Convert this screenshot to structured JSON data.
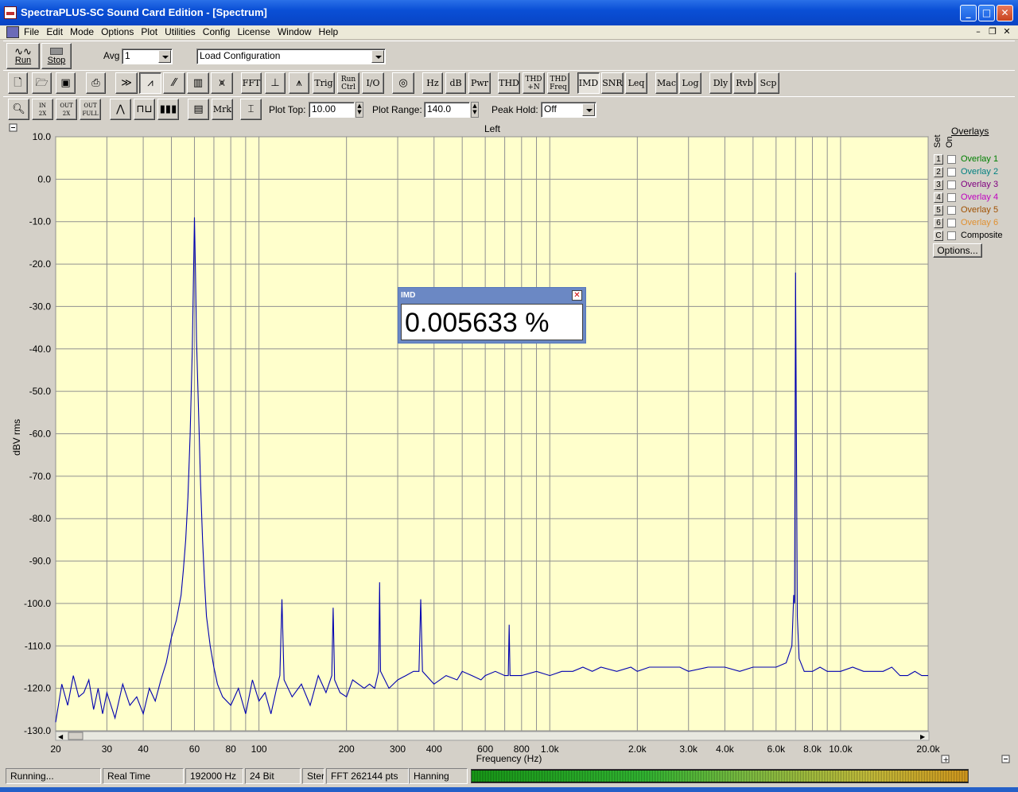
{
  "window": {
    "title": "SpectraPLUS-SC Sound Card Edition - [Spectrum]"
  },
  "menu": [
    "File",
    "Edit",
    "Mode",
    "Options",
    "Plot",
    "Utilities",
    "Config",
    "License",
    "Window",
    "Help"
  ],
  "toolbar1": {
    "run_label": "Run",
    "stop_label": "Stop",
    "avg_label": "Avg",
    "avg_value": "1",
    "config_value": "Load Configuration"
  },
  "toolbar2": {
    "buttons": [
      "FFT",
      "Trig",
      "Run Ctrl",
      "I/O",
      "Hz",
      "dB",
      "Pwr",
      "THD",
      "THD +N",
      "THD Freq",
      "IMD",
      "SNR",
      "Leq",
      "Mac",
      "Log",
      "Dly",
      "Rvb",
      "Scp"
    ]
  },
  "toolbar3": {
    "marker_label": "Mrk",
    "plot_top_label": "Plot Top:",
    "plot_top_value": "10.00",
    "plot_range_label": "Plot Range:",
    "plot_range_value": "140.0",
    "peak_hold_label": "Peak Hold:",
    "peak_hold_value": "Off"
  },
  "overlays": {
    "title": "Overlays",
    "set_label": "Set",
    "on_label": "On",
    "items": [
      {
        "set": "1",
        "label": "Overlay 1",
        "color": "#008000"
      },
      {
        "set": "2",
        "label": "Overlay 2",
        "color": "#008080"
      },
      {
        "set": "3",
        "label": "Overlay 3",
        "color": "#800080"
      },
      {
        "set": "4",
        "label": "Overlay 4",
        "color": "#c000c0"
      },
      {
        "set": "5",
        "label": "Overlay 5",
        "color": "#a05000"
      },
      {
        "set": "6",
        "label": "Overlay 6",
        "color": "#e09030"
      },
      {
        "set": "C",
        "label": "Composite",
        "color": "#000000"
      }
    ],
    "options_label": "Options..."
  },
  "imd_popup": {
    "title": "IMD",
    "value": "0.005633 %"
  },
  "status": {
    "state": "Running...",
    "mode": "Real Time",
    "sample_rate": "192000 Hz",
    "bits": "24 Bit",
    "channels": "Stereo",
    "fft": "FFT 262144 pts",
    "window": "Hanning",
    "level": 1.0
  },
  "chart_data": {
    "type": "line",
    "title": "Left",
    "xlabel": "Frequency (Hz)",
    "ylabel": "dBV rms",
    "x_scale": "log",
    "xlim": [
      20,
      20000
    ],
    "ylim": [
      -130,
      10
    ],
    "grid": true,
    "background": "#ffffcc",
    "line_color": "#0000b0",
    "x_ticks": [
      20,
      30,
      40,
      60,
      80,
      100,
      200,
      300,
      400,
      600,
      800,
      1000,
      2000,
      3000,
      4000,
      6000,
      8000,
      10000,
      20000
    ],
    "x_tick_labels": [
      "20",
      "30",
      "40",
      "60",
      "80",
      "100",
      "200",
      "300",
      "400",
      "600",
      "800",
      "1.0k",
      "2.0k",
      "3.0k",
      "4.0k",
      "6.0k",
      "8.0k",
      "10.0k",
      "20.0k"
    ],
    "y_ticks": [
      10,
      0,
      -10,
      -20,
      -30,
      -40,
      -50,
      -60,
      -70,
      -80,
      -90,
      -100,
      -110,
      -120,
      -130
    ],
    "y_tick_labels": [
      "10.0",
      "0.0",
      "-10.0",
      "-20.0",
      "-30.0",
      "-40.0",
      "-50.0",
      "-60.0",
      "-70.0",
      "-80.0",
      "-90.0",
      "-100.0",
      "-110.0",
      "-120.0",
      "-130.0"
    ],
    "series": [
      {
        "points": [
          [
            20,
            -128
          ],
          [
            21,
            -119
          ],
          [
            22,
            -124
          ],
          [
            23,
            -117
          ],
          [
            24,
            -122
          ],
          [
            25,
            -121
          ],
          [
            26,
            -118
          ],
          [
            27,
            -125
          ],
          [
            28,
            -120
          ],
          [
            29,
            -126
          ],
          [
            30,
            -121
          ],
          [
            32,
            -127
          ],
          [
            34,
            -119
          ],
          [
            36,
            -124
          ],
          [
            38,
            -122
          ],
          [
            40,
            -126
          ],
          [
            42,
            -120
          ],
          [
            44,
            -123
          ],
          [
            46,
            -118
          ],
          [
            48,
            -114
          ],
          [
            50,
            -108
          ],
          [
            52,
            -104
          ],
          [
            54,
            -98
          ],
          [
            55,
            -92
          ],
          [
            56,
            -85
          ],
          [
            57,
            -75
          ],
          [
            58,
            -60
          ],
          [
            59,
            -40
          ],
          [
            59.5,
            -25
          ],
          [
            60,
            -9
          ],
          [
            60.5,
            -22
          ],
          [
            61,
            -38
          ],
          [
            62,
            -55
          ],
          [
            63,
            -72
          ],
          [
            64,
            -85
          ],
          [
            65,
            -95
          ],
          [
            66,
            -103
          ],
          [
            68,
            -110
          ],
          [
            70,
            -115
          ],
          [
            72,
            -119
          ],
          [
            75,
            -122
          ],
          [
            80,
            -124
          ],
          [
            85,
            -120
          ],
          [
            90,
            -126
          ],
          [
            95,
            -118
          ],
          [
            100,
            -123
          ],
          [
            105,
            -121
          ],
          [
            110,
            -126
          ],
          [
            115,
            -120
          ],
          [
            118,
            -117
          ],
          [
            120,
            -99
          ],
          [
            122,
            -118
          ],
          [
            130,
            -122
          ],
          [
            140,
            -119
          ],
          [
            150,
            -124
          ],
          [
            160,
            -117
          ],
          [
            170,
            -121
          ],
          [
            178,
            -117
          ],
          [
            180,
            -101
          ],
          [
            182,
            -118
          ],
          [
            190,
            -121
          ],
          [
            200,
            -122
          ],
          [
            210,
            -118
          ],
          [
            230,
            -120
          ],
          [
            240,
            -119
          ],
          [
            250,
            -120
          ],
          [
            258,
            -116
          ],
          [
            260,
            -95
          ],
          [
            262,
            -116
          ],
          [
            280,
            -120
          ],
          [
            300,
            -118
          ],
          [
            320,
            -117
          ],
          [
            340,
            -116
          ],
          [
            355,
            -116
          ],
          [
            360,
            -99
          ],
          [
            365,
            -116
          ],
          [
            400,
            -119
          ],
          [
            440,
            -117
          ],
          [
            480,
            -118
          ],
          [
            500,
            -116
          ],
          [
            540,
            -117
          ],
          [
            580,
            -118
          ],
          [
            600,
            -117
          ],
          [
            650,
            -116
          ],
          [
            700,
            -117
          ],
          [
            720,
            -117
          ],
          [
            725,
            -105
          ],
          [
            730,
            -117
          ],
          [
            800,
            -117
          ],
          [
            900,
            -116
          ],
          [
            1000,
            -117
          ],
          [
            1100,
            -116
          ],
          [
            1200,
            -116
          ],
          [
            1300,
            -115
          ],
          [
            1400,
            -116
          ],
          [
            1500,
            -115
          ],
          [
            1700,
            -116
          ],
          [
            1900,
            -115
          ],
          [
            2000,
            -116
          ],
          [
            2200,
            -115
          ],
          [
            2500,
            -115
          ],
          [
            2800,
            -115
          ],
          [
            3000,
            -116
          ],
          [
            3500,
            -115
          ],
          [
            4000,
            -115
          ],
          [
            4500,
            -116
          ],
          [
            5000,
            -115
          ],
          [
            5500,
            -115
          ],
          [
            6000,
            -115
          ],
          [
            6500,
            -114
          ],
          [
            6800,
            -110
          ],
          [
            6900,
            -98
          ],
          [
            6950,
            -100
          ],
          [
            7000,
            -22
          ],
          [
            7050,
            -62
          ],
          [
            7100,
            -103
          ],
          [
            7200,
            -113
          ],
          [
            7500,
            -116
          ],
          [
            8000,
            -116
          ],
          [
            8500,
            -115
          ],
          [
            9000,
            -116
          ],
          [
            10000,
            -116
          ],
          [
            11000,
            -115
          ],
          [
            12000,
            -116
          ],
          [
            13000,
            -116
          ],
          [
            14000,
            -116
          ],
          [
            15000,
            -115
          ],
          [
            16000,
            -117
          ],
          [
            17000,
            -117
          ],
          [
            18000,
            -116
          ],
          [
            19000,
            -117
          ],
          [
            20000,
            -117
          ]
        ]
      }
    ]
  }
}
